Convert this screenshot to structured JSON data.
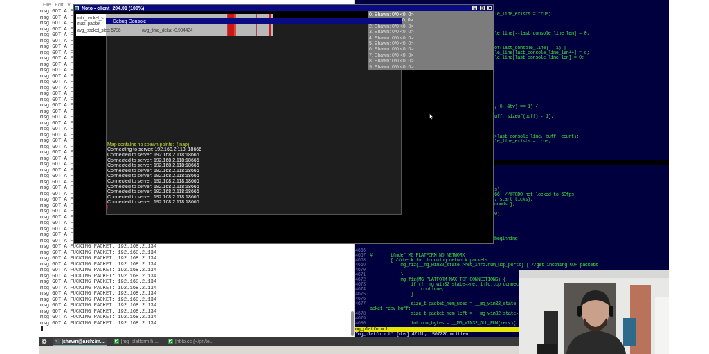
{
  "terminal": {
    "menu": [
      "File",
      "Edit",
      "V"
    ],
    "lines": [
      "msg GOT A F",
      "msg GOT A F",
      "msg GOT A F",
      "msg GOT A F",
      "msg GOT A F",
      "msg GOT A F",
      "msg GOT A F",
      "msg GOT A F",
      "msg GOT A F",
      "msg GOT A F",
      "msg GOT A F",
      "msg GOT A F",
      "msg GOT A F",
      "msg GOT A F",
      "msg GOT A F",
      "msg GOT A F",
      "msg GOT A F",
      "msg GOT A F",
      "msg GOT A F",
      "msg GOT A F",
      "msg GOT A F",
      "msg GOT A F",
      "msg GOT A F",
      "msg GOT A F",
      "msg GOT A F",
      "msg GOT A F",
      "msg GOT A F",
      "msg GOT A F",
      "msg GOT A F",
      "msg GOT A F",
      "msg GOT A F",
      "msg GOT A F",
      "msg GOT A F",
      "msg GOT A F",
      "msg GOT A F",
      "msg GOT A F",
      "msg GOT A F",
      "msg GOT A F",
      "msg GOT A F",
      "msg GOT A F",
      "msg GOT A FUCKING PACKET: 192.168.2.134",
      "msg GOT A FUCKING PACKET: 192.168.2.134",
      "msg GOT A FUCKING PACKET: 192.168.2.134",
      "msg GOT A FUCKING PACKET: 192.168.2.134",
      "msg GOT A FUCKING PACKET: 192.168.2.134",
      "msg GOT A FUCKING PACKET: 192.168.2.134",
      "msg GOT A FUCKING PACKET: 192.168.2.134",
      "msg GOT A FUCKING PACKET: 192.168.2.134",
      "msg GOT A FUCKING PACKET: 192.168.2.134",
      "msg GOT A FUCKING PACKET: 192.168.2.134",
      "msg GOT A FUCKING PACKET: 192.168.2.134",
      "msg GOT A FUCKING PACKET: 192.168.2.134",
      "msg GOT A FUCKING PACKET: 192.168.2.134",
      "msg GOT A FUCKING PACKET: 192.168.2.134"
    ]
  },
  "game_window": {
    "title": "Noto - client",
    "subtitle": "204.01 (100%)",
    "stats": [
      "min_packet_s",
      "max_packet_",
      "avg_packet_size: 5796",
      "avg_time_delta: -0.994424"
    ],
    "players": [
      {
        "kind": "full",
        "text": "0. Shawn: 0/0 <0, 0>"
      },
      {
        "kind": "cut",
        "text": "0, 0>"
      },
      {
        "kind": "dim",
        "text": "2. Shawn: 0/0 <0, 0>"
      },
      {
        "kind": "dim",
        "text": "3. Shawn: 0/0 <0, 0>"
      },
      {
        "kind": "dim",
        "text": "4. Shawn: 0/0 <0, 0>"
      },
      {
        "kind": "dim",
        "text": "5. Shawn: 0/0 <0, 0>"
      },
      {
        "kind": "dim",
        "text": "6. Shawn: 0/0 <0, 0>"
      },
      {
        "kind": "dim",
        "text": "7. Shawn: 0/0 <0, 0>"
      },
      {
        "kind": "dim",
        "text": "8. Shawn: 0/0 <0, 0>"
      },
      {
        "kind": "dim",
        "text": "9. Shawn: 0/0 <0, 0>"
      }
    ],
    "debug_console": {
      "title": "Debug Console",
      "lines": [
        {
          "kind": "warning",
          "text": "Map contains no spawn points:  (.nap)"
        },
        {
          "kind": "info",
          "text": "Connecting to server: 192.168.2.118: 18666"
        },
        {
          "kind": "info",
          "text": "Connected to server: 192.168.2.118:18666"
        },
        {
          "kind": "info",
          "text": "Connected to server: 192.168.2.118:18666"
        },
        {
          "kind": "info",
          "text": "Connected to server: 192.168.2.118:18666"
        },
        {
          "kind": "info",
          "text": "Connected to server: 192.168.2.118:18666"
        },
        {
          "kind": "info",
          "text": "Connected to server: 192.168.2.118:18666"
        },
        {
          "kind": "info",
          "text": "Connected to server: 192.168.2.118:18666"
        },
        {
          "kind": "info",
          "text": "Connected to server: 192.168.2.118:18666"
        },
        {
          "kind": "info",
          "text": "Connected to server: 192.168.2.118:18666"
        },
        {
          "kind": "info",
          "text": "Connected to server: 192.168.2.118:18666"
        },
        {
          "kind": "info",
          "text": "Connected to server: 192.168.2.118:18666"
        }
      ]
    }
  },
  "editor": {
    "upper_rows": [
      {
        "kind": "code",
        "text": "le_line_exists = true;"
      },
      {
        "kind": "blank"
      },
      {
        "kind": "blank"
      },
      {
        "kind": "blank"
      },
      {
        "kind": "code",
        "text": "le_line[--last_console_line_len] = 0;"
      },
      {
        "kind": "blank"
      },
      {
        "kind": "blank"
      },
      {
        "kind": "code",
        "text": "of(last_console_line) - 1) {"
      },
      {
        "kind": "code",
        "text": "le_line[last_console_line_len++] = c;"
      },
      {
        "kind": "code",
        "text": "le_line[last_console_line_len] = 0;"
      },
      {
        "kind": "blank"
      },
      {
        "kind": "blank"
      },
      {
        "kind": "blank"
      },
      {
        "kind": "blank"
      },
      {
        "kind": "blank"
      },
      {
        "kind": "blank"
      },
      {
        "kind": "blank"
      },
      {
        "kind": "blank"
      },
      {
        "kind": "blank"
      },
      {
        "kind": "code",
        "text": ", 0, &tv) == 1) {"
      },
      {
        "kind": "blank"
      },
      {
        "kind": "code",
        "text": "uff, sizeof(buff) - 1);"
      },
      {
        "kind": "blank"
      },
      {
        "kind": "blank"
      },
      {
        "kind": "blank"
      },
      {
        "kind": "code",
        "text": ">last_console_line, buff, count);"
      },
      {
        "kind": "code",
        "text": "le_line_exists = true;"
      }
    ],
    "middle_rows": [
      {
        "kind": "blank"
      },
      {
        "kind": "blank"
      },
      {
        "kind": "blank"
      },
      {
        "kind": "blank"
      },
      {
        "kind": "code",
        "text": "s);"
      },
      {
        "kind": "code",
        "text": "66; //@TODO not locked to 60fps"
      },
      {
        "kind": "code",
        "text": ", start_ticks);"
      },
      {
        "kind": "code",
        "text": "conds };"
      },
      {
        "kind": "blank"
      },
      {
        "kind": "code",
        "text": "0);"
      },
      {
        "kind": "blank"
      },
      {
        "kind": "blank"
      },
      {
        "kind": "blank"
      },
      {
        "kind": "blank"
      },
      {
        "kind": "code",
        "text": "beginning"
      }
    ],
    "lower_rows": [
      {
        "number": "4666"
      },
      {
        "number": "4667",
        "text": "#       ifndef MG_PLATFORM_NO_NETWORK"
      },
      {
        "number": "4668",
        "text": "        { //check for incoming network packets"
      },
      {
        "number": "4669",
        "text": "            mg_fiz(__mg_win32_state->net_info.num_udp_ports) { //get incoming UDP packets"
      },
      {
        "number": "4670"
      },
      {
        "number": "4671",
        "text": "            }"
      },
      {
        "number": "4672",
        "text": "            mg_fiz(MG_PLATFORM_MAX_TCP_CONNECTIONS) {"
      },
      {
        "number": "4673",
        "text": "                if (!__mg_win32_state->net_info.tcp_connec"
      },
      {
        "number": "4674",
        "text": "                    continue;"
      },
      {
        "number": "4675",
        "text": "                }"
      },
      {
        "number": "4676"
      },
      {
        "number": "4677",
        "text": "                size_t packet_mem_used = __mg_win32_state-"
      },
      {
        "text": "acket_recv_buff;"
      },
      {
        "number": "4678",
        "text": "                size_t packet_mem_left = __mg_win32_state-"
      },
      {
        "number": "4679"
      },
      {
        "number": "4680",
        "text": "                int num_bytes = __MG_WIN32_DLL_FUN(recv)("
      }
    ],
    "status_file": "mg_platform.h",
    "message": "\"mg_platform.h\" [dos] 4711L, 150722C written"
  },
  "taskbar": {
    "tasks": [
      {
        "kind": "terminal",
        "label": "|shawn@arch:/m...",
        "selected": true
      },
      {
        "kind": "editor",
        "label": "|mg_platform.h ...",
        "selected": false
      },
      {
        "kind": "editor",
        "label": "|nbio.cc (~/prj/te...",
        "selected": false
      }
    ]
  }
}
